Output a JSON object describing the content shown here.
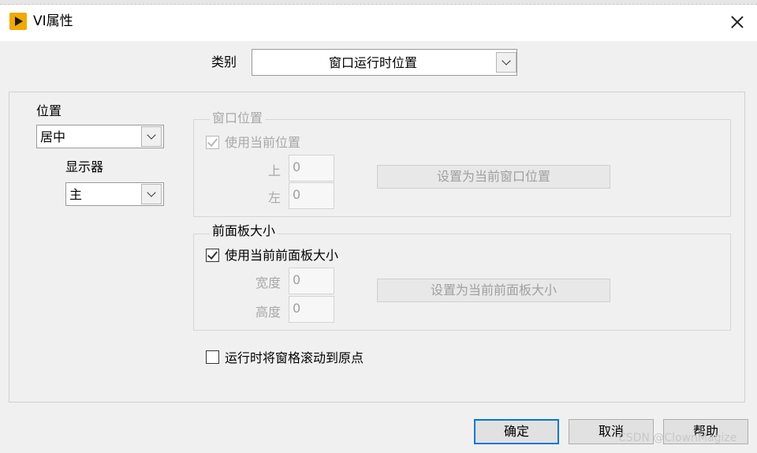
{
  "window": {
    "title": "VI属性",
    "icon": "labview-vi-icon",
    "close_icon": "close-icon"
  },
  "category": {
    "label": "类别",
    "selected": "窗口运行时位置"
  },
  "position": {
    "label": "位置",
    "selected": "居中",
    "monitor_label": "显示器",
    "monitor_selected": "主"
  },
  "window_position": {
    "title": "窗口位置",
    "use_current_label": "使用当前位置",
    "use_current_checked": true,
    "enabled": false,
    "top_label": "上",
    "top_value": "0",
    "left_label": "左",
    "left_value": "0",
    "set_button": "设置为当前窗口位置"
  },
  "panel_size": {
    "title": "前面板大小",
    "use_current_label": "使用当前前面板大小",
    "use_current_checked": true,
    "width_label": "宽度",
    "width_value": "0",
    "height_label": "高度",
    "height_value": "0",
    "set_button": "设置为当前前面板大小"
  },
  "scroll_origin": {
    "label": "运行时将窗格滚动到原点",
    "checked": false
  },
  "buttons": {
    "ok": "确定",
    "cancel": "取消",
    "help": "帮助"
  },
  "watermark": "CSDN @ClownMagize",
  "colors": {
    "accent": "#0078d7",
    "icon_bg": "#f2a900",
    "disabled_text": "#a8a8a8"
  }
}
